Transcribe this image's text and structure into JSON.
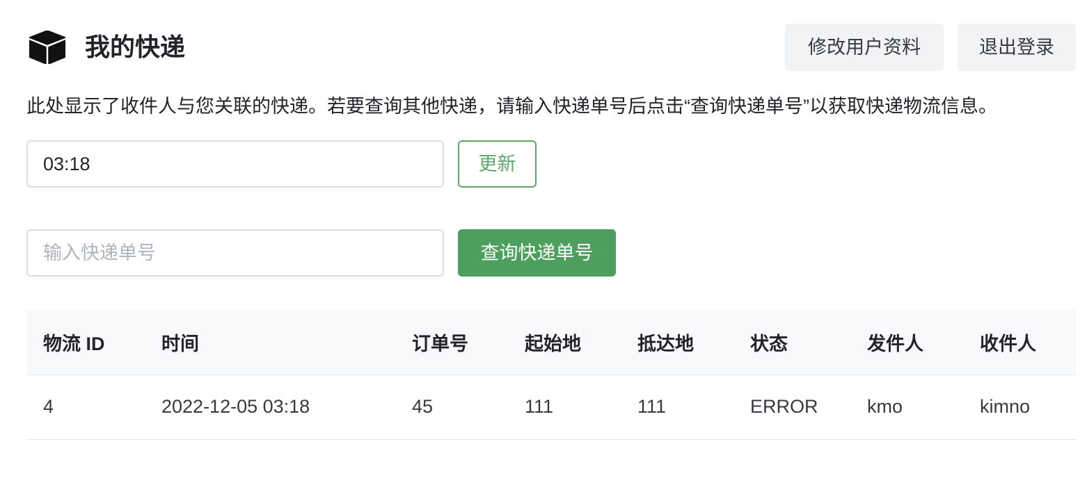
{
  "header": {
    "title": "我的快递",
    "icon": "package-box-icon",
    "edit_profile_label": "修改用户资料",
    "logout_label": "退出登录"
  },
  "description": "此处显示了收件人与您关联的快递。若要查询其他快递，请输入快递单号后点击“查询快递单号”以获取快递物流信息。",
  "refresh": {
    "value": "03:18",
    "button_label": "更新"
  },
  "query": {
    "placeholder": "输入快递单号",
    "button_label": "查询快递单号"
  },
  "table": {
    "columns": [
      "物流 ID",
      "时间",
      "订单号",
      "起始地",
      "抵达地",
      "状态",
      "发件人",
      "收件人"
    ],
    "rows": [
      [
        "4",
        "2022-12-05 03:18",
        "45",
        "111",
        "111",
        "ERROR",
        "kmo",
        "kimno"
      ]
    ]
  },
  "colors": {
    "primary_green": "#4d9f5e",
    "outline_green": "#5aa76b",
    "button_gray": "#f1f3f5",
    "table_header_bg": "#f8f9fa",
    "text": "#212529"
  }
}
